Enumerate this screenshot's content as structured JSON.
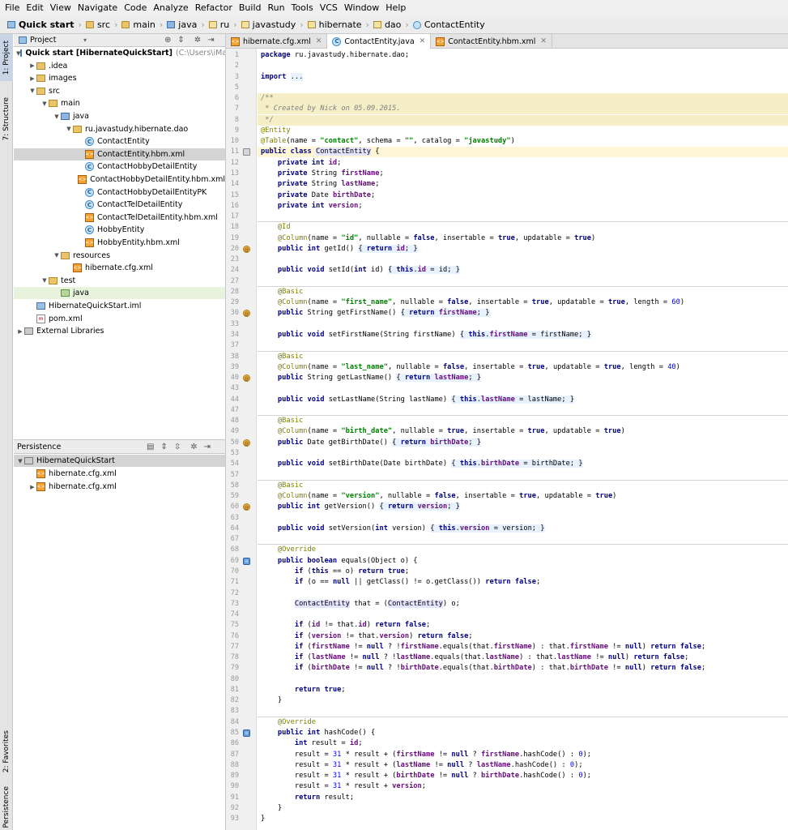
{
  "menu": [
    "File",
    "Edit",
    "View",
    "Navigate",
    "Code",
    "Analyze",
    "Refactor",
    "Build",
    "Run",
    "Tools",
    "VCS",
    "Window",
    "Help"
  ],
  "breadcrumbs": [
    "Quick start",
    "src",
    "main",
    "java",
    "ru",
    "javastudy",
    "hibernate",
    "dao",
    "ContactEntity"
  ],
  "side_tabs": {
    "project": "1: Project",
    "structure": "7: Structure",
    "favorites": "2: Favorites",
    "persistence": "Persistence"
  },
  "project_panel": {
    "title": "Project"
  },
  "project_tree": [
    {
      "label": "Quick start [HibernateQuickStart]",
      "extra": "(C:\\Users\\iMacPC\\D",
      "icon": "mod",
      "arrow": "▼",
      "depth": 0,
      "bold": true
    },
    {
      "label": ".idea",
      "icon": "dir",
      "arrow": "▶",
      "depth": 1
    },
    {
      "label": "images",
      "icon": "dir",
      "arrow": "▶",
      "depth": 1
    },
    {
      "label": "src",
      "icon": "dir",
      "arrow": "▼",
      "depth": 1
    },
    {
      "label": "main",
      "icon": "dir",
      "arrow": "▼",
      "depth": 2
    },
    {
      "label": "java",
      "icon": "dirb",
      "arrow": "▼",
      "depth": 3
    },
    {
      "label": "ru.javastudy.hibernate.dao",
      "icon": "pkg",
      "arrow": "▼",
      "depth": 4
    },
    {
      "label": "ContactEntity",
      "icon": "cls",
      "arrow": "",
      "depth": 5
    },
    {
      "label": "ContactEntity.hbm.xml",
      "icon": "xml",
      "arrow": "",
      "depth": 5,
      "selected": true
    },
    {
      "label": "ContactHobbyDetailEntity",
      "icon": "cls",
      "arrow": "",
      "depth": 5
    },
    {
      "label": "ContactHobbyDetailEntity.hbm.xml",
      "icon": "xml",
      "arrow": "",
      "depth": 5
    },
    {
      "label": "ContactHobbyDetailEntityPK",
      "icon": "cls",
      "arrow": "",
      "depth": 5
    },
    {
      "label": "ContactTelDetailEntity",
      "icon": "cls",
      "arrow": "",
      "depth": 5
    },
    {
      "label": "ContactTelDetailEntity.hbm.xml",
      "icon": "xml",
      "arrow": "",
      "depth": 5
    },
    {
      "label": "HobbyEntity",
      "icon": "cls",
      "arrow": "",
      "depth": 5
    },
    {
      "label": "HobbyEntity.hbm.xml",
      "icon": "xml",
      "arrow": "",
      "depth": 5
    },
    {
      "label": "resources",
      "icon": "dir",
      "arrow": "▼",
      "depth": 3
    },
    {
      "label": "hibernate.cfg.xml",
      "icon": "xml",
      "arrow": "",
      "depth": 4
    },
    {
      "label": "test",
      "icon": "dir",
      "arrow": "▼",
      "depth": 2
    },
    {
      "label": "java",
      "icon": "dirg",
      "arrow": "",
      "depth": 3,
      "highlight": true
    },
    {
      "label": "HibernateQuickStart.iml",
      "icon": "mod",
      "arrow": "",
      "depth": 1
    },
    {
      "label": "pom.xml",
      "icon": "mvn",
      "arrow": "",
      "depth": 1
    },
    {
      "label": "External Libraries",
      "icon": "jar",
      "arrow": "▶",
      "depth": 0
    }
  ],
  "persistence_panel": {
    "title": "Persistence"
  },
  "persistence_tree": [
    {
      "label": "HibernateQuickStart",
      "icon": "jar",
      "arrow": "▼",
      "depth": 0,
      "selected": true
    },
    {
      "label": "hibernate.cfg.xml",
      "icon": "xml",
      "arrow": "",
      "depth": 1
    },
    {
      "label": "hibernate.cfg.xml",
      "icon": "xml",
      "arrow": "▶",
      "depth": 1
    }
  ],
  "editor_tabs": [
    {
      "label": "hibernate.cfg.xml",
      "icon": "xml",
      "active": false
    },
    {
      "label": "ContactEntity.java",
      "icon": "cls",
      "active": true
    },
    {
      "label": "ContactEntity.hbm.xml",
      "icon": "xml",
      "active": false
    }
  ],
  "code_lines": [
    {
      "n": "1",
      "html": "<span class='kw'>package</span> ru.javastudy.hibernate.dao;"
    },
    {
      "n": "2",
      "html": ""
    },
    {
      "n": "3",
      "html": "<span class='kw'>import</span> <span class='fold2'>...</span>"
    },
    {
      "n": "5",
      "html": ""
    },
    {
      "n": "6",
      "html": "<span class='com'>/**</span>",
      "cls": "cmt"
    },
    {
      "n": "7",
      "html": "<span class='com'> * Created by Nick on 05.09.2015.</span>",
      "cls": "cmt"
    },
    {
      "n": "8",
      "html": "<span class='com'> */</span>",
      "cls": "cmt"
    },
    {
      "n": "9",
      "html": "<span class='ann'>@Entity</span>"
    },
    {
      "n": "10",
      "html": "<span class='ann'>@Table</span>(name = <span class='str'>\"contact\"</span>, schema = <span class='str'>\"\"</span>, catalog = <span class='str'>\"javastudy\"</span>)"
    },
    {
      "n": "11",
      "html": "<span class='kw'>public class</span> <span class='hlcls'>ContactEntity</span> {",
      "cls": "cur"
    },
    {
      "n": "12",
      "html": "    <span class='kw'>private int</span> <span class='fld'>id</span>;"
    },
    {
      "n": "13",
      "html": "    <span class='kw'>private</span> String <span class='fld'>firstName</span>;"
    },
    {
      "n": "14",
      "html": "    <span class='kw'>private</span> String <span class='fld'>lastName</span>;"
    },
    {
      "n": "15",
      "html": "    <span class='kw'>private</span> Date <span class='fld'>birthDate</span>;"
    },
    {
      "n": "16",
      "html": "    <span class='kw'>private int</span> <span class='fld'>version</span>;"
    },
    {
      "n": "17",
      "html": ""
    },
    {
      "n": "18",
      "html": "    <span class='ann'>@Id</span>"
    },
    {
      "n": "19",
      "html": "    <span class='ann'>@Column</span>(name = <span class='str'>\"id\"</span>, nullable = <span class='kw'>false</span>, insertable = <span class='kw'>true</span>, updatable = <span class='kw'>true</span>)"
    },
    {
      "n": "20",
      "html": "    <span class='kw'>public int</span> getId() <span class='fold2'>{ <span class='kw'>return</span> <span class='fld'>id</span>; }</span>"
    },
    {
      "n": "23",
      "html": ""
    },
    {
      "n": "24",
      "html": "    <span class='kw'>public void</span> setId(<span class='kw'>int</span> id) <span class='fold2'>{ <span class='kw'>this</span>.<span class='fld'>id</span> = id; }</span>"
    },
    {
      "n": "27",
      "html": ""
    },
    {
      "n": "28",
      "html": "    <span class='ann'>@Basic</span>"
    },
    {
      "n": "29",
      "html": "    <span class='ann'>@Column</span>(name = <span class='str'>\"first_name\"</span>, nullable = <span class='kw'>false</span>, insertable = <span class='kw'>true</span>, updatable = <span class='kw'>true</span>, length = <span class='num'>60</span>)"
    },
    {
      "n": "30",
      "html": "    <span class='kw'>public</span> String getFirstName() <span class='fold2'>{ <span class='kw'>return</span> <span class='fld'>firstName</span>; }</span>"
    },
    {
      "n": "33",
      "html": ""
    },
    {
      "n": "34",
      "html": "    <span class='kw'>public void</span> setFirstName(String firstName) <span class='fold2'>{ <span class='kw'>this</span>.<span class='fld'>firstName</span> = firstName; }</span>"
    },
    {
      "n": "37",
      "html": ""
    },
    {
      "n": "38",
      "html": "    <span class='ann'>@Basic</span>"
    },
    {
      "n": "39",
      "html": "    <span class='ann'>@Column</span>(name = <span class='str'>\"last_name\"</span>, nullable = <span class='kw'>false</span>, insertable = <span class='kw'>true</span>, updatable = <span class='kw'>true</span>, length = <span class='num'>40</span>)"
    },
    {
      "n": "40",
      "html": "    <span class='kw'>public</span> String getLastName() <span class='fold2'>{ <span class='kw'>return</span> <span class='fld'>lastName</span>; }</span>"
    },
    {
      "n": "43",
      "html": ""
    },
    {
      "n": "44",
      "html": "    <span class='kw'>public void</span> setLastName(String lastName) <span class='fold2'>{ <span class='kw'>this</span>.<span class='fld'>lastName</span> = lastName; }</span>"
    },
    {
      "n": "47",
      "html": ""
    },
    {
      "n": "48",
      "html": "    <span class='ann'>@Basic</span>"
    },
    {
      "n": "49",
      "html": "    <span class='ann'>@Column</span>(name = <span class='str'>\"birth_date\"</span>, nullable = <span class='kw'>true</span>, insertable = <span class='kw'>true</span>, updatable = <span class='kw'>true</span>)"
    },
    {
      "n": "50",
      "html": "    <span class='kw'>public</span> Date getBirthDate() <span class='fold2'>{ <span class='kw'>return</span> <span class='fld'>birthDate</span>; }</span>"
    },
    {
      "n": "53",
      "html": ""
    },
    {
      "n": "54",
      "html": "    <span class='kw'>public void</span> setBirthDate(Date birthDate) <span class='fold2'>{ <span class='kw'>this</span>.<span class='fld'>birthDate</span> = birthDate; }</span>"
    },
    {
      "n": "57",
      "html": ""
    },
    {
      "n": "58",
      "html": "    <span class='ann'>@Basic</span>"
    },
    {
      "n": "59",
      "html": "    <span class='ann'>@Column</span>(name = <span class='str'>\"version\"</span>, nullable = <span class='kw'>false</span>, insertable = <span class='kw'>true</span>, updatable = <span class='kw'>true</span>)"
    },
    {
      "n": "60",
      "html": "    <span class='kw'>public int</span> getVersion() <span class='fold2'>{ <span class='kw'>return</span> <span class='fld'>version</span>; }</span>"
    },
    {
      "n": "63",
      "html": ""
    },
    {
      "n": "64",
      "html": "    <span class='kw'>public void</span> setVersion(<span class='kw'>int</span> version) <span class='fold2'>{ <span class='kw'>this</span>.<span class='fld'>version</span> = version; }</span>"
    },
    {
      "n": "67",
      "html": ""
    },
    {
      "n": "68",
      "html": "    <span class='ann'>@Override</span>"
    },
    {
      "n": "69",
      "html": "    <span class='kw'>public boolean</span> equals(Object o) {"
    },
    {
      "n": "70",
      "html": "        <span class='kw'>if</span> (<span class='kw'>this</span> == o) <span class='kw'>return true</span>;"
    },
    {
      "n": "71",
      "html": "        <span class='kw'>if</span> (o == <span class='kw'>null</span> || getClass() != o.getClass()) <span class='kw'>return false</span>;"
    },
    {
      "n": "72",
      "html": ""
    },
    {
      "n": "73",
      "html": "        <span class='hlcls'>ContactEntity</span> that = (<span class='hlcls'>ContactEntity</span>) o;"
    },
    {
      "n": "74",
      "html": ""
    },
    {
      "n": "75",
      "html": "        <span class='kw'>if</span> (<span class='fld'>id</span> != that.<span class='fld'>id</span>) <span class='kw'>return false</span>;"
    },
    {
      "n": "76",
      "html": "        <span class='kw'>if</span> (<span class='fld'>version</span> != that.<span class='fld'>version</span>) <span class='kw'>return false</span>;"
    },
    {
      "n": "77",
      "html": "        <span class='kw'>if</span> (<span class='fld'>firstName</span> != <span class='kw'>null</span> ? !<span class='fld'>firstName</span>.equals(that.<span class='fld'>firstName</span>) : that.<span class='fld'>firstName</span> != <span class='kw'>null</span>) <span class='kw'>return false</span>;"
    },
    {
      "n": "78",
      "html": "        <span class='kw'>if</span> (<span class='fld'>lastName</span> != <span class='kw'>null</span> ? !<span class='fld'>lastName</span>.equals(that.<span class='fld'>lastName</span>) : that.<span class='fld'>lastName</span> != <span class='kw'>null</span>) <span class='kw'>return false</span>;"
    },
    {
      "n": "79",
      "html": "        <span class='kw'>if</span> (<span class='fld'>birthDate</span> != <span class='kw'>null</span> ? !<span class='fld'>birthDate</span>.equals(that.<span class='fld'>birthDate</span>) : that.<span class='fld'>birthDate</span> != <span class='kw'>null</span>) <span class='kw'>return false</span>;"
    },
    {
      "n": "80",
      "html": ""
    },
    {
      "n": "81",
      "html": "        <span class='kw'>return true</span>;"
    },
    {
      "n": "82",
      "html": "    }"
    },
    {
      "n": "83",
      "html": ""
    },
    {
      "n": "84",
      "html": "    <span class='ann'>@Override</span>"
    },
    {
      "n": "85",
      "html": "    <span class='kw'>public int</span> hashCode() {"
    },
    {
      "n": "86",
      "html": "        <span class='kw'>int</span> result = <span class='fld'>id</span>;"
    },
    {
      "n": "87",
      "html": "        result = <span class='num'>31</span> * result + (<span class='fld'>firstName</span> != <span class='kw'>null</span> ? <span class='fld'>firstName</span>.hashCode() : <span class='num'>0</span>);"
    },
    {
      "n": "88",
      "html": "        result = <span class='num'>31</span> * result + (<span class='fld'>lastName</span> != <span class='kw'>null</span> ? <span class='fld'>lastName</span>.hashCode() : <span class='num'>0</span>);"
    },
    {
      "n": "89",
      "html": "        result = <span class='num'>31</span> * result + (<span class='fld'>birthDate</span> != <span class='kw'>null</span> ? <span class='fld'>birthDate</span>.hashCode() : <span class='num'>0</span>);"
    },
    {
      "n": "90",
      "html": "        result = <span class='num'>31</span> * result + <span class='fld'>version</span>;"
    },
    {
      "n": "91",
      "html": "        <span class='kw'>return</span> result;"
    },
    {
      "n": "92",
      "html": "    }"
    },
    {
      "n": "93",
      "html": "}"
    }
  ],
  "gutter_markers": [
    {
      "line": "11",
      "kind": "t",
      "sym": ""
    },
    {
      "line": "20",
      "kind": "a",
      "sym": "@"
    },
    {
      "line": "30",
      "kind": "a",
      "sym": "@"
    },
    {
      "line": "40",
      "kind": "a",
      "sym": "@"
    },
    {
      "line": "50",
      "kind": "a",
      "sym": "@"
    },
    {
      "line": "60",
      "kind": "a",
      "sym": "@"
    },
    {
      "line": "69",
      "kind": "o",
      "sym": "o"
    },
    {
      "line": "85",
      "kind": "o",
      "sym": "o"
    }
  ]
}
